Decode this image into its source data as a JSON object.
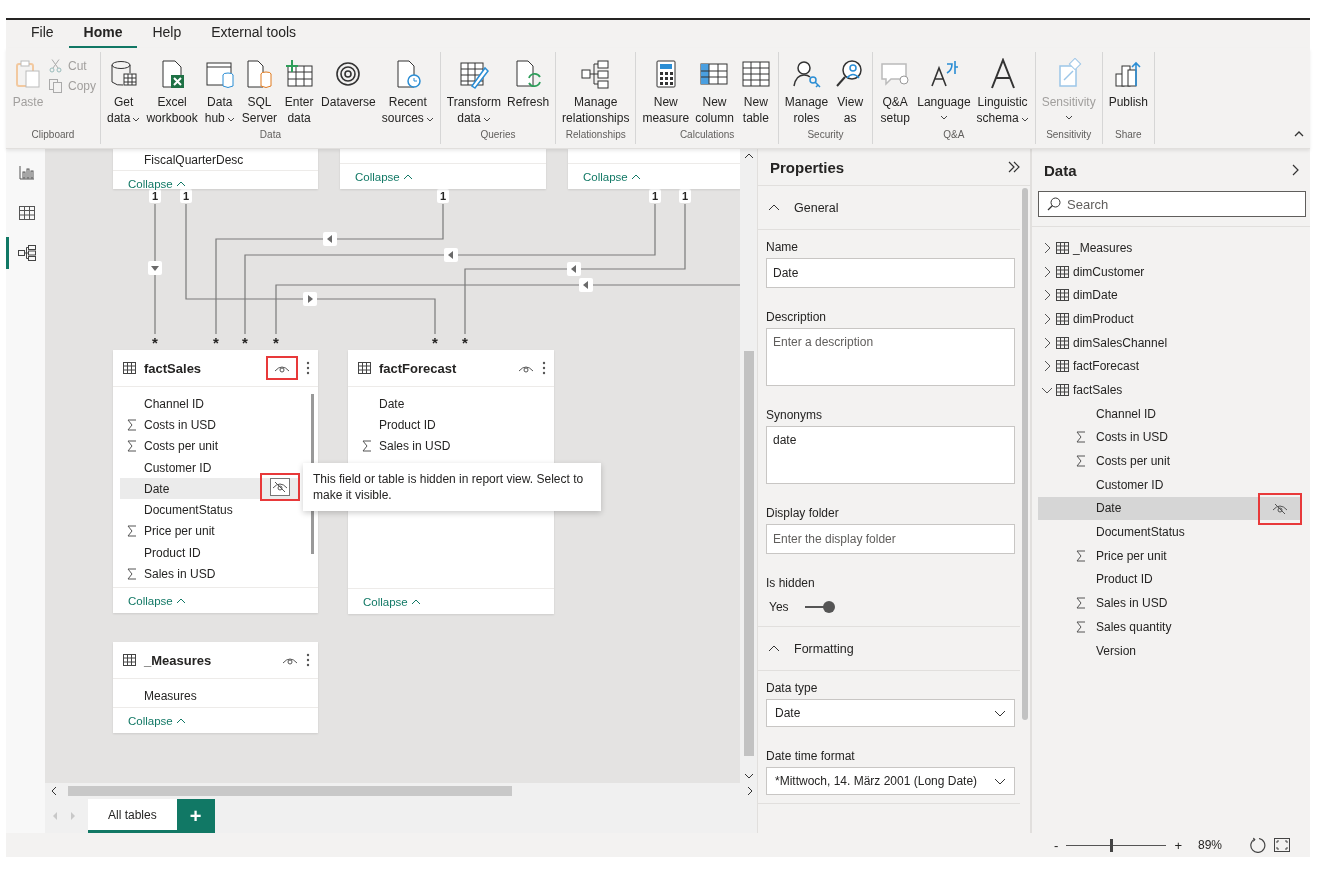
{
  "menu_tabs": [
    {
      "label": "File",
      "selected": false
    },
    {
      "label": "Home",
      "selected": true
    },
    {
      "label": "Help",
      "selected": false
    },
    {
      "label": "External tools",
      "selected": false
    }
  ],
  "ribbon": {
    "groups": [
      {
        "label": "Clipboard",
        "buttons": [
          {
            "kind": "large",
            "lines": [
              "Paste"
            ],
            "dropdown": false,
            "disabled": true
          },
          {
            "kind": "small",
            "lines": [
              "Cut"
            ],
            "dropdown": false,
            "disabled": true
          },
          {
            "kind": "small",
            "lines": [
              "Copy"
            ],
            "dropdown": false,
            "disabled": true
          }
        ]
      },
      {
        "label": "Data",
        "buttons": [
          {
            "kind": "large",
            "lines": [
              "Get",
              "data"
            ],
            "dropdown": true,
            "disabled": false
          },
          {
            "kind": "large",
            "lines": [
              "Excel",
              "workbook"
            ],
            "dropdown": false,
            "disabled": false
          },
          {
            "kind": "large",
            "lines": [
              "Data",
              "hub"
            ],
            "dropdown": true,
            "disabled": false
          },
          {
            "kind": "large",
            "lines": [
              "SQL",
              "Server"
            ],
            "dropdown": false,
            "disabled": false
          },
          {
            "kind": "large",
            "lines": [
              "Enter",
              "data"
            ],
            "dropdown": false,
            "disabled": false
          },
          {
            "kind": "large",
            "lines": [
              "Dataverse"
            ],
            "dropdown": false,
            "disabled": false
          },
          {
            "kind": "large",
            "lines": [
              "Recent",
              "sources"
            ],
            "dropdown": true,
            "disabled": false
          }
        ]
      },
      {
        "label": "Queries",
        "buttons": [
          {
            "kind": "large",
            "lines": [
              "Transform",
              "data"
            ],
            "dropdown": true,
            "disabled": false
          },
          {
            "kind": "large",
            "lines": [
              "Refresh"
            ],
            "dropdown": false,
            "disabled": false
          }
        ]
      },
      {
        "label": "Relationships",
        "buttons": [
          {
            "kind": "large",
            "lines": [
              "Manage",
              "relationships"
            ],
            "dropdown": false,
            "disabled": false
          }
        ]
      },
      {
        "label": "Calculations",
        "buttons": [
          {
            "kind": "large",
            "lines": [
              "New",
              "measure"
            ],
            "dropdown": false,
            "disabled": false
          },
          {
            "kind": "large",
            "lines": [
              "New",
              "column"
            ],
            "dropdown": false,
            "disabled": false
          },
          {
            "kind": "large",
            "lines": [
              "New",
              "table"
            ],
            "dropdown": false,
            "disabled": false
          }
        ]
      },
      {
        "label": "Security",
        "buttons": [
          {
            "kind": "large",
            "lines": [
              "Manage",
              "roles"
            ],
            "dropdown": false,
            "disabled": false
          },
          {
            "kind": "large",
            "lines": [
              "View",
              "as"
            ],
            "dropdown": false,
            "disabled": false
          }
        ]
      },
      {
        "label": "Q&A",
        "buttons": [
          {
            "kind": "large",
            "lines": [
              "Q&A",
              "setup"
            ],
            "dropdown": false,
            "disabled": false
          },
          {
            "kind": "large",
            "lines": [
              "Language"
            ],
            "dropdown": true,
            "disabled": false
          },
          {
            "kind": "large",
            "lines": [
              "Linguistic",
              "schema"
            ],
            "dropdown": true,
            "disabled": false
          }
        ]
      },
      {
        "label": "Sensitivity",
        "buttons": [
          {
            "kind": "large",
            "lines": [
              "Sensitivity"
            ],
            "dropdown": true,
            "disabled": true
          }
        ]
      },
      {
        "label": "Share",
        "buttons": [
          {
            "kind": "large",
            "lines": [
              "Publish"
            ],
            "dropdown": false,
            "disabled": false
          }
        ]
      }
    ]
  },
  "nav": [
    {
      "selected": false
    },
    {
      "selected": false
    },
    {
      "selected": true
    }
  ],
  "canvas": {
    "tables": [
      {
        "fields": [
          {
            "name": "FiscalQuarterDesc",
            "kind": "column",
            "selected": false,
            "hidden": false
          }
        ],
        "collapse": "Collapse"
      },
      {
        "collapse": "Collapse"
      },
      {
        "collapse": "Collapse"
      },
      {
        "name": "factSales",
        "highlighted": true,
        "fields": [
          {
            "name": "Channel ID",
            "kind": "column",
            "selected": false,
            "hidden": false
          },
          {
            "name": "Costs in USD",
            "kind": "measure",
            "selected": false,
            "hidden": false
          },
          {
            "name": "Costs per unit",
            "kind": "measure",
            "selected": false,
            "hidden": false
          },
          {
            "name": "Customer ID",
            "kind": "column",
            "selected": false,
            "hidden": false
          },
          {
            "name": "Date",
            "kind": "column",
            "selected": true,
            "hidden": true,
            "highlighted": true
          },
          {
            "name": "DocumentStatus",
            "kind": "column",
            "selected": false,
            "hidden": false
          },
          {
            "name": "Price per unit",
            "kind": "measure",
            "selected": false,
            "hidden": false
          },
          {
            "name": "Product ID",
            "kind": "column",
            "selected": false,
            "hidden": false
          },
          {
            "name": "Sales in USD",
            "kind": "measure",
            "selected": false,
            "hidden": false
          }
        ],
        "collapse": "Collapse"
      },
      {
        "name": "factForecast",
        "highlighted": false,
        "fields": [
          {
            "name": "Date",
            "kind": "column",
            "selected": false,
            "hidden": false
          },
          {
            "name": "Product ID",
            "kind": "column",
            "selected": false,
            "hidden": false
          },
          {
            "name": "Sales in USD",
            "kind": "measure",
            "selected": false,
            "hidden": false
          }
        ],
        "collapse": "Collapse"
      },
      {
        "name": "_Measures",
        "highlighted": false,
        "fields": [
          {
            "name": "Measures",
            "kind": "column",
            "selected": false,
            "hidden": false
          }
        ],
        "collapse": "Collapse"
      }
    ],
    "one_ends": [
      "1",
      "1",
      "1",
      "1",
      "1"
    ],
    "many_ends": [
      "*",
      "*",
      "*",
      "*",
      "*",
      "*"
    ],
    "tooltip": "This field or table is hidden in report view. Select to make it visible.",
    "tabs": [
      {
        "label": "All tables",
        "selected": true
      }
    ],
    "add_tab": "+"
  },
  "properties": {
    "title": "Properties",
    "sections": [
      {
        "label": "General",
        "expanded": true,
        "fields": [
          {
            "kind": "text",
            "label": "Name",
            "value": "Date"
          },
          {
            "kind": "textarea",
            "label": "Description",
            "placeholder": "Enter a description"
          },
          {
            "kind": "textarea",
            "label": "Synonyms",
            "value": "date"
          },
          {
            "kind": "text",
            "label": "Display folder",
            "placeholder": "Enter the display folder"
          },
          {
            "kind": "toggle",
            "label": "Is hidden",
            "value_label": "Yes",
            "on": true
          }
        ]
      },
      {
        "label": "Formatting",
        "expanded": true,
        "fields": [
          {
            "kind": "select",
            "label": "Data type",
            "value": "Date"
          },
          {
            "kind": "select",
            "label": "Date time format",
            "value": "*Mittwoch, 14. März 2001 (Long Date)"
          }
        ]
      }
    ]
  },
  "data_pane": {
    "title": "Data",
    "search": {
      "placeholder": "Search"
    },
    "items": [
      {
        "name": "_Measures",
        "expanded": false
      },
      {
        "name": "dimCustomer",
        "expanded": false
      },
      {
        "name": "dimDate",
        "expanded": false
      },
      {
        "name": "dimProduct",
        "expanded": false
      },
      {
        "name": "dimSalesChannel",
        "expanded": false
      },
      {
        "name": "factForecast",
        "expanded": false
      },
      {
        "name": "factSales",
        "expanded": true,
        "children": [
          {
            "name": "Channel ID",
            "kind": "column",
            "selected": false,
            "hidden": false
          },
          {
            "name": "Costs in USD",
            "kind": "measure",
            "selected": false,
            "hidden": false
          },
          {
            "name": "Costs per unit",
            "kind": "measure",
            "selected": false,
            "hidden": false
          },
          {
            "name": "Customer ID",
            "kind": "column",
            "selected": false,
            "hidden": false
          },
          {
            "name": "Date",
            "kind": "column",
            "selected": true,
            "hidden": true,
            "highlighted": true
          },
          {
            "name": "DocumentStatus",
            "kind": "column",
            "selected": false,
            "hidden": false
          },
          {
            "name": "Price per unit",
            "kind": "measure",
            "selected": false,
            "hidden": false
          },
          {
            "name": "Product ID",
            "kind": "column",
            "selected": false,
            "hidden": false
          },
          {
            "name": "Sales in USD",
            "kind": "measure",
            "selected": false,
            "hidden": false
          },
          {
            "name": "Sales quantity",
            "kind": "measure",
            "selected": false,
            "hidden": false
          },
          {
            "name": "Version",
            "kind": "column",
            "selected": false,
            "hidden": false
          }
        ]
      }
    ]
  },
  "status_bar": {
    "zoom_out": "-",
    "zoom_in": "+",
    "level": 0.44,
    "reading": "89%"
  }
}
